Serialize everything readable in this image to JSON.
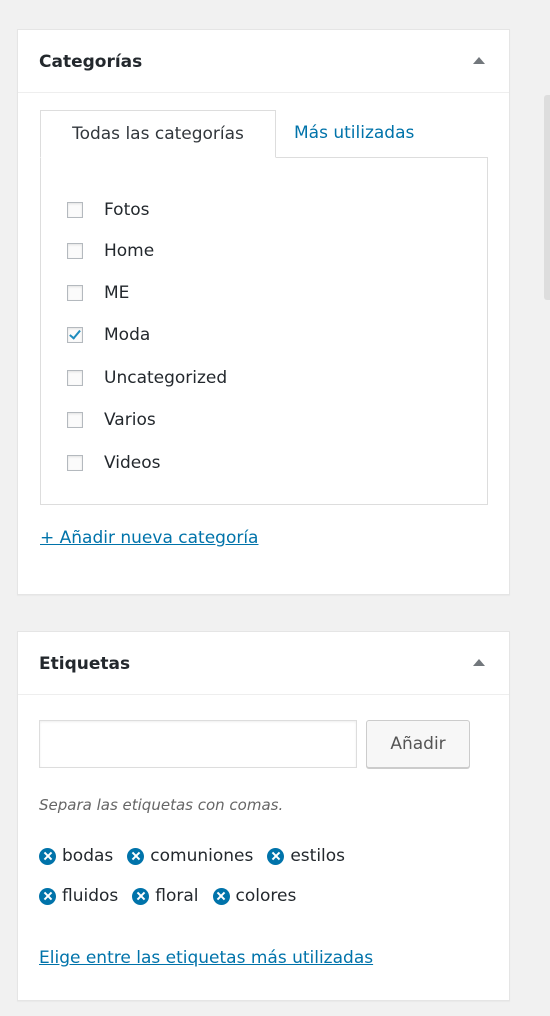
{
  "categories_box": {
    "title": "Categorías",
    "tabs": [
      {
        "label": "Todas las categorías",
        "active": true
      },
      {
        "label": "Más utilizadas",
        "active": false
      }
    ],
    "items": [
      {
        "label": "Fotos",
        "checked": false
      },
      {
        "label": "Home",
        "checked": false
      },
      {
        "label": "ME",
        "checked": false
      },
      {
        "label": "Moda",
        "checked": true
      },
      {
        "label": "Uncategorized",
        "checked": false
      },
      {
        "label": "Varios",
        "checked": false
      },
      {
        "label": "Videos",
        "checked": false
      }
    ],
    "add_link": "+ Añadir nueva categoría"
  },
  "tags_box": {
    "title": "Etiquetas",
    "input_value": "",
    "add_button": "Añadir",
    "help_text": "Separa las etiquetas con comas.",
    "tags": [
      "bodas",
      "comuniones",
      "estilos",
      "fluidos",
      "floral",
      "colores"
    ],
    "popular_link": "Elige entre las etiquetas más utilizadas"
  },
  "colors": {
    "link": "#0073aa",
    "checkmark": "#1e8cbe"
  },
  "icons": {
    "toggle": "triangle-up-icon",
    "tag_remove": "remove-x-circle-icon"
  }
}
